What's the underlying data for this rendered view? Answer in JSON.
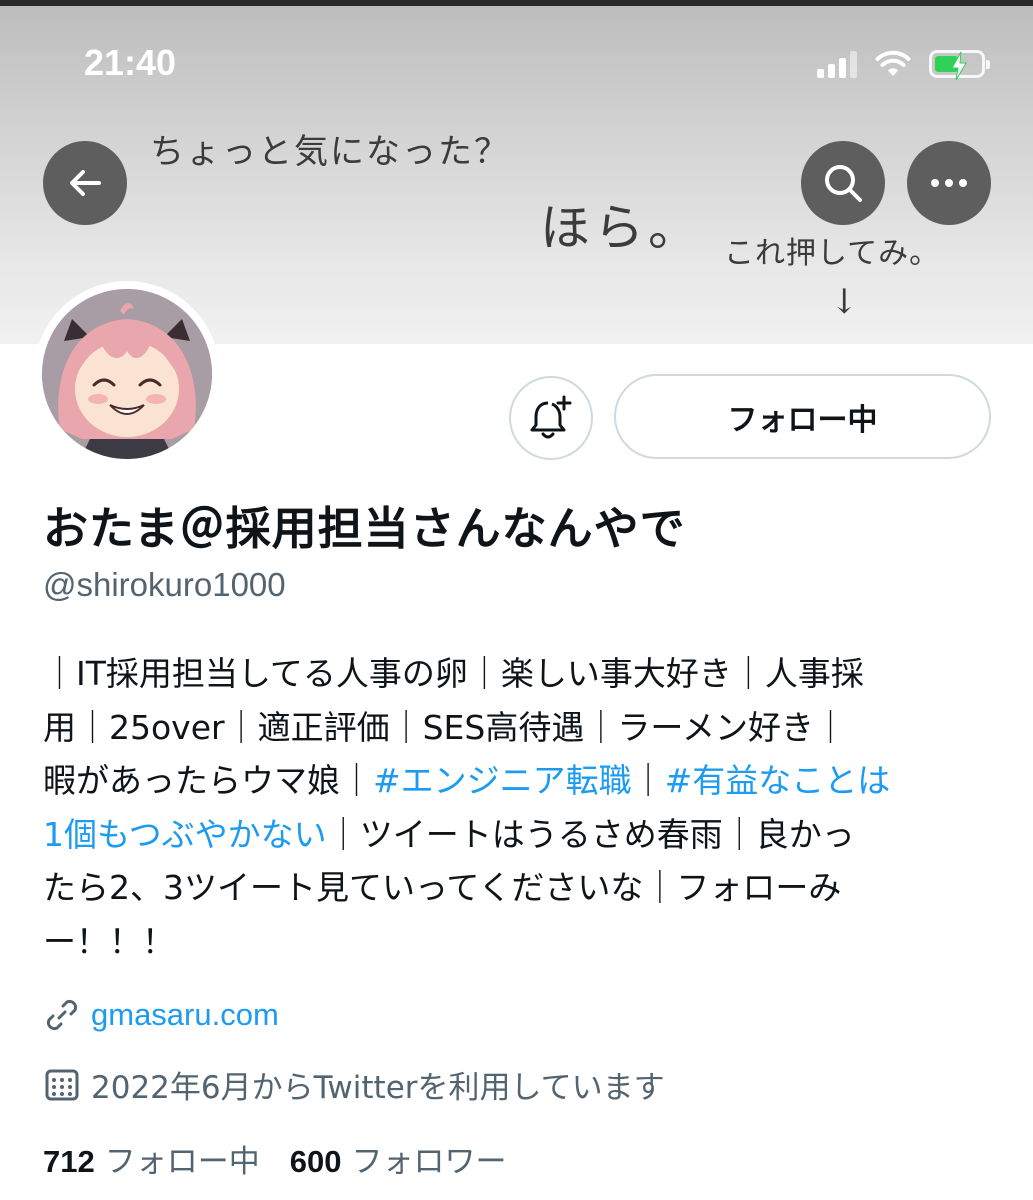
{
  "status_bar": {
    "time": "21:40"
  },
  "banner": {
    "line1": "ちょっと気になった？",
    "line2": "ほら。",
    "line3": "これ押してみ。",
    "arrow": "↓"
  },
  "profile": {
    "display_name": "おたま＠採用担当さんなんやで",
    "handle": "@shirokuro1000",
    "follow_button_label": "フォロー中",
    "bio": {
      "line1": "｜IT採用担当してる人事の卵｜楽しい事大好き｜人事採",
      "line2": "用｜25over｜適正評価｜SES高待遇｜ラーメン好き｜",
      "line3_pre": "暇があったらウマ娘｜",
      "line3_tag1": "#エンジニア転職",
      "line3_mid": "｜",
      "line3_tag2": "#有益なことは",
      "line4_tag2_cont": "1個もつぶやかない",
      "line4_post": "｜ツイートはうるさめ春雨｜良かっ",
      "line5": "たら2、3ツイート見ていってくださいな｜フォローみ",
      "line6": "ー！！！"
    },
    "website": "gmasaru.com",
    "joined": "2022年6月からTwitterを利用しています",
    "following_count": "712",
    "following_label": "フォロー中",
    "followers_count": "600",
    "followers_label": "フォロワー"
  },
  "colors": {
    "accent": "#1d9bf0",
    "secondary_text": "#536471",
    "primary_text": "#0f1419"
  },
  "icons": [
    "back-arrow-icon",
    "search-icon",
    "more-icon",
    "notification-bell-add-icon",
    "link-icon",
    "calendar-icon",
    "wifi-icon",
    "signal-icon",
    "battery-icon"
  ]
}
